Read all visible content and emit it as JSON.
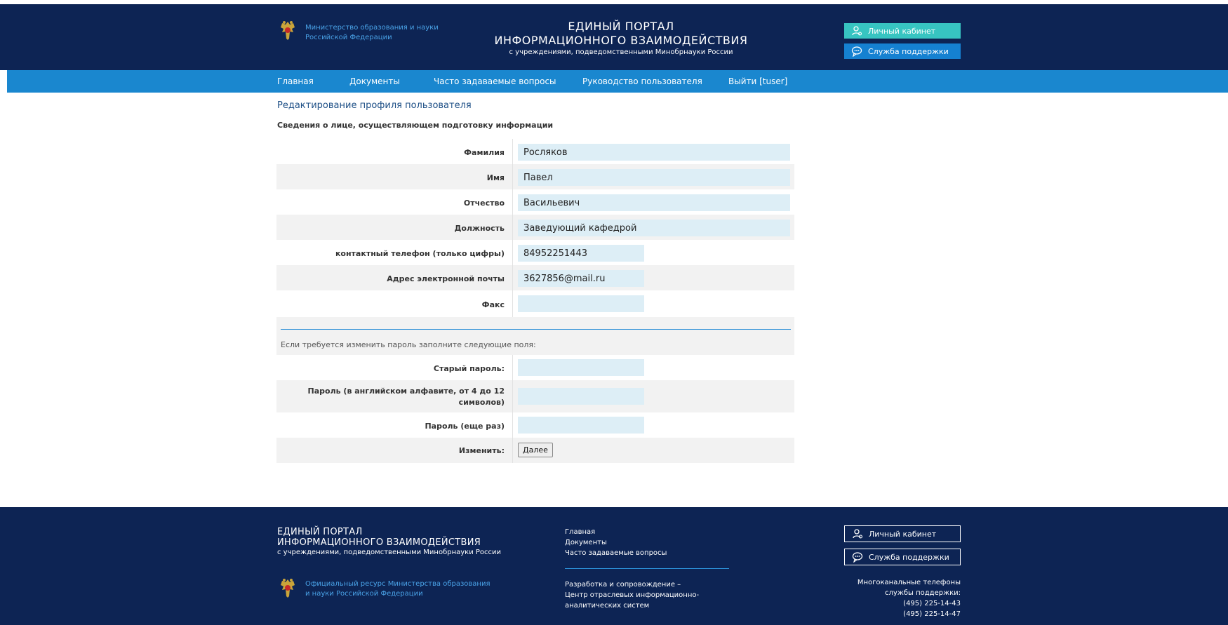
{
  "header": {
    "ministry_line1": "Министерство образования и науки",
    "ministry_line2": "Российской Федерации",
    "title_line1": "ЕДИНЫЙ ПОРТАЛ",
    "title_line2": "ИНФОРМАЦИОННОГО ВЗАИМОДЕЙСТВИЯ",
    "title_line3": "с учреждениями, подведомственными Минобрнауки России",
    "cabinet_label": "Личный кабинет",
    "support_label": "Служба поддержки",
    "cabinet_icon": "user-icon",
    "support_icon": "chat-icon",
    "emblem_icon": "emblem-icon"
  },
  "nav": {
    "items": [
      {
        "label": "Главная"
      },
      {
        "label": "Документы"
      },
      {
        "label": "Часто задаваемые вопросы"
      },
      {
        "label": "Руководство пользователя"
      },
      {
        "label": "Выйти [tuser]"
      }
    ]
  },
  "main": {
    "title": "Редактирование профиля пользователя",
    "section_title": "Сведения о лице, осуществляющем подготовку информации",
    "fields": {
      "surname": {
        "label": "Фамилия",
        "value": "Росляков"
      },
      "name": {
        "label": "Имя",
        "value": "Павел"
      },
      "patronymic": {
        "label": "Отчество",
        "value": "Васильевич"
      },
      "position": {
        "label": "Должность",
        "value": "Заведующий кафедрой"
      },
      "phone": {
        "label": "контактный телефон (только цифры)",
        "value": "84952251443"
      },
      "email": {
        "label": "Адрес электронной почты",
        "value": "3627856@mail.ru"
      },
      "fax": {
        "label": "Факс",
        "value": ""
      }
    },
    "password": {
      "note": "Если требуется изменить пароль заполните следующие поля:",
      "old_label": "Старый пароль:",
      "new_label_line1": "Пароль (в английском алфавите, от 4 до 12",
      "new_label_line2": "символов)",
      "repeat_label": "Пароль (еще раз)",
      "change_label": "Изменить:",
      "submit_label": "Далее"
    }
  },
  "footer": {
    "title_line1": "ЕДИНЫЙ ПОРТАЛ",
    "title_line2": "ИНФОРМАЦИОННОГО ВЗАИМОДЕЙСТВИЯ",
    "title_line3": "с учреждениями, подведомственными Минобрнауки России",
    "official_line1": "Официальный ресурс Министерства образования",
    "official_line2": "и науки Российской Федерации",
    "links": [
      {
        "label": "Главная"
      },
      {
        "label": "Документы"
      },
      {
        "label": "Часто задаваемые вопросы"
      }
    ],
    "dev_line1": "Разработка и сопровождение –",
    "dev_line2": "Центр отраслевых информационно-",
    "dev_line3": "аналитических систем",
    "cabinet_label": "Личный кабинет",
    "support_label": "Служба поддержки",
    "phones_line1": "Многоканальные телефоны",
    "phones_line2": "службы поддержки:",
    "phone1": "(495) 225-14-43",
    "phone2": "(495) 225-14-47"
  },
  "colors": {
    "header_bg": "#0d2454",
    "nav_bg": "#1a87cf",
    "cabinet_btn": "#37c4c1",
    "support_btn": "#1581d1",
    "field_bg": "#ddeef6"
  }
}
